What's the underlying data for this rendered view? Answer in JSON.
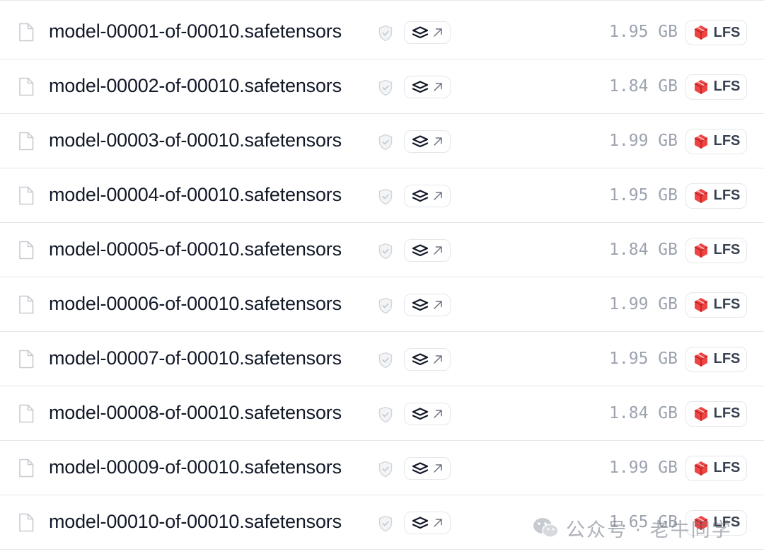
{
  "files": [
    {
      "name": "model-00001-of-00010.safetensors",
      "size": "1.95 GB",
      "lfs_label": "LFS"
    },
    {
      "name": "model-00002-of-00010.safetensors",
      "size": "1.84 GB",
      "lfs_label": "LFS"
    },
    {
      "name": "model-00003-of-00010.safetensors",
      "size": "1.99 GB",
      "lfs_label": "LFS"
    },
    {
      "name": "model-00004-of-00010.safetensors",
      "size": "1.95 GB",
      "lfs_label": "LFS"
    },
    {
      "name": "model-00005-of-00010.safetensors",
      "size": "1.84 GB",
      "lfs_label": "LFS"
    },
    {
      "name": "model-00006-of-00010.safetensors",
      "size": "1.99 GB",
      "lfs_label": "LFS"
    },
    {
      "name": "model-00007-of-00010.safetensors",
      "size": "1.95 GB",
      "lfs_label": "LFS"
    },
    {
      "name": "model-00008-of-00010.safetensors",
      "size": "1.84 GB",
      "lfs_label": "LFS"
    },
    {
      "name": "model-00009-of-00010.safetensors",
      "size": "1.99 GB",
      "lfs_label": "LFS"
    },
    {
      "name": "model-00010-of-00010.safetensors",
      "size": "1.65 GB",
      "lfs_label": "LFS"
    }
  ],
  "icons": {
    "file": "file-icon",
    "shield": "shield-check-icon",
    "viewer": "layers-icon",
    "external": "arrow-up-right-icon",
    "lfs": "lfs-cube-icon"
  },
  "colors": {
    "lfs_red": "#ef4444",
    "size_gray": "#9ca3af",
    "border": "#e5e7eb"
  },
  "watermark": {
    "text": "公众号 · 老牛同学"
  }
}
